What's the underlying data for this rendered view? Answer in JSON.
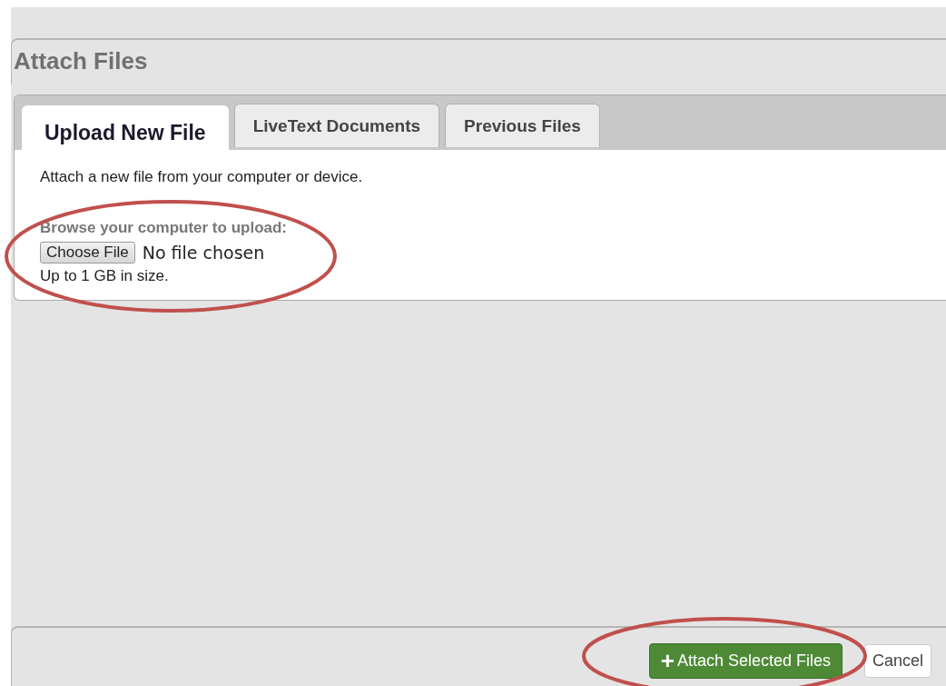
{
  "dialog": {
    "title": "Attach Files"
  },
  "tabs": [
    {
      "label": "Upload New File",
      "selected": true
    },
    {
      "label": "LiveText Documents",
      "selected": false
    },
    {
      "label": "Previous Files",
      "selected": false
    }
  ],
  "upload": {
    "intro": "Attach a new file from your computer or device.",
    "browse_label": "Browse your computer to upload:",
    "choose_button": "Choose File",
    "file_status": "No file chosen",
    "size_note": "Up to 1 GB in size."
  },
  "buttons": [
    {
      "label": "Attach Selected Files",
      "kind": "primary",
      "icon": "+"
    },
    {
      "label": "Cancel",
      "kind": "secondary"
    }
  ]
}
